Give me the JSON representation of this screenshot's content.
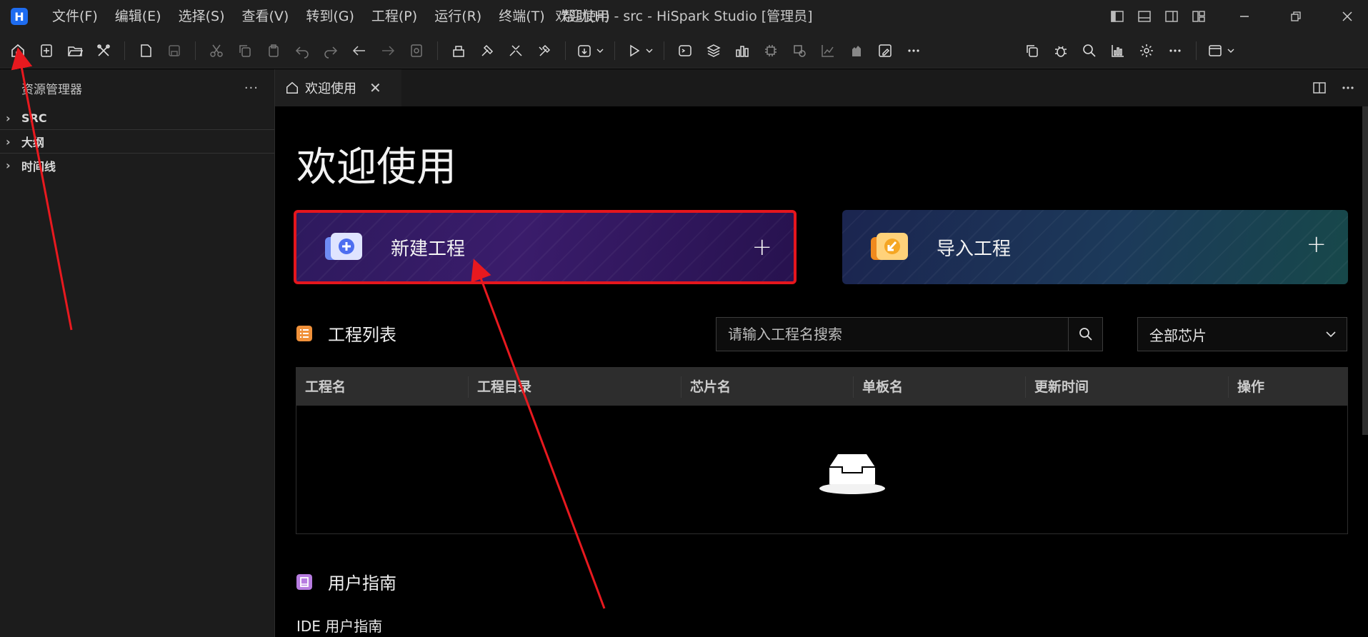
{
  "app": {
    "logo": "H",
    "window_title": "欢迎使用 - src - HiSpark Studio [管理员]"
  },
  "menu": [
    "文件(F)",
    "编辑(E)",
    "选择(S)",
    "查看(V)",
    "转到(G)",
    "工程(P)",
    "运行(R)",
    "终端(T)",
    "帮助(H)"
  ],
  "sidebar": {
    "title": "资源管理器",
    "more": "···",
    "sections": [
      "SRC",
      "大纲",
      "时间线"
    ]
  },
  "tab": {
    "label": "欢迎使用",
    "close": "✕"
  },
  "welcome": {
    "title": "欢迎使用",
    "new_project": "新建工程",
    "import_project": "导入工程",
    "plus": "+"
  },
  "project_list": {
    "title": "工程列表",
    "search_placeholder": "请输入工程名搜索",
    "chip_filter": "全部芯片",
    "columns": [
      "工程名",
      "工程目录",
      "芯片名",
      "单板名",
      "更新时间",
      "操作"
    ]
  },
  "user_guide": {
    "title": "用户指南",
    "link": "IDE 用户指南"
  },
  "colors": {
    "highlight_border": "#e5161d",
    "annotation_arrow": "#e8191f",
    "list_icon": "#f0913a",
    "guide_icon": "#b77ce0"
  }
}
